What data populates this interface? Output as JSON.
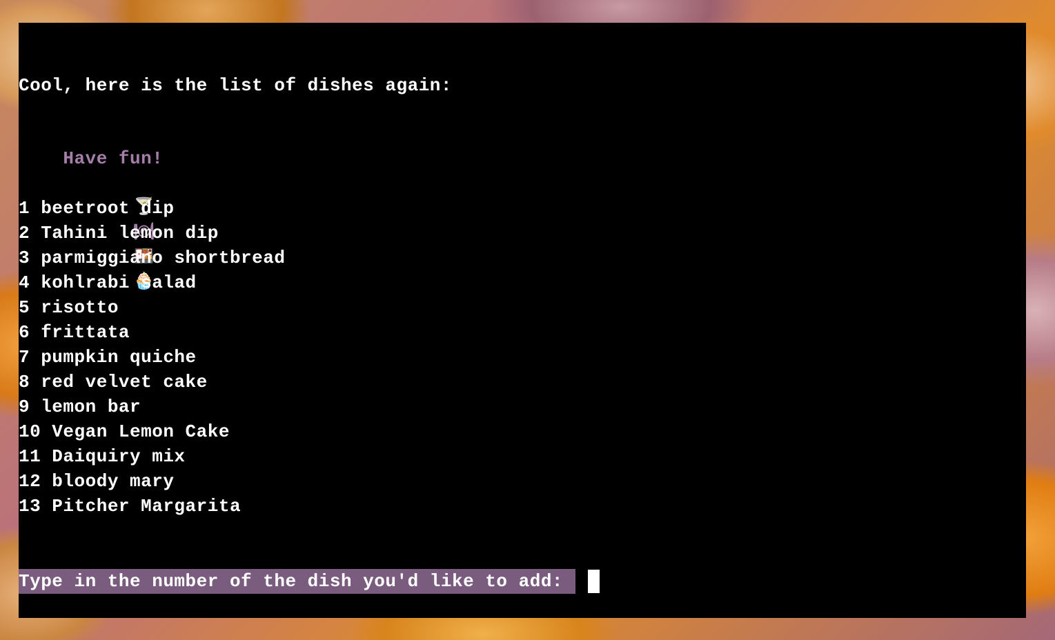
{
  "terminal": {
    "intro_text": "Cool, here is the list of dishes again:",
    "fun_text": "Have fun!",
    "emojis": [
      {
        "glyph": "🍸",
        "icon": "cocktail-icon"
      },
      {
        "glyph": "🍽",
        "icon": "plate-icon"
      },
      {
        "glyph": "🍱",
        "icon": "bento-icon"
      },
      {
        "glyph": "🧁",
        "icon": "cupcake-icon"
      }
    ],
    "dishes": [
      "1 beetroot dip",
      "2 Tahini lemon dip",
      "3 parmiggiano shortbread",
      "4 kohlrabi salad",
      "5 risotto",
      "6 frittata",
      "7 pumpkin quiche",
      "8 red velvet cake",
      "9 lemon bar",
      "10 Vegan Lemon Cake",
      "11 Daiquiry mix",
      "12 bloody mary",
      "13 Pitcher Margarita"
    ],
    "prompt_text": "Type in the number of the dish you'd like to add: ",
    "colors": {
      "background": "#000000",
      "text": "#ffffff",
      "accent": "#a57fa9",
      "prompt_highlight": "#7a5c7e"
    }
  }
}
